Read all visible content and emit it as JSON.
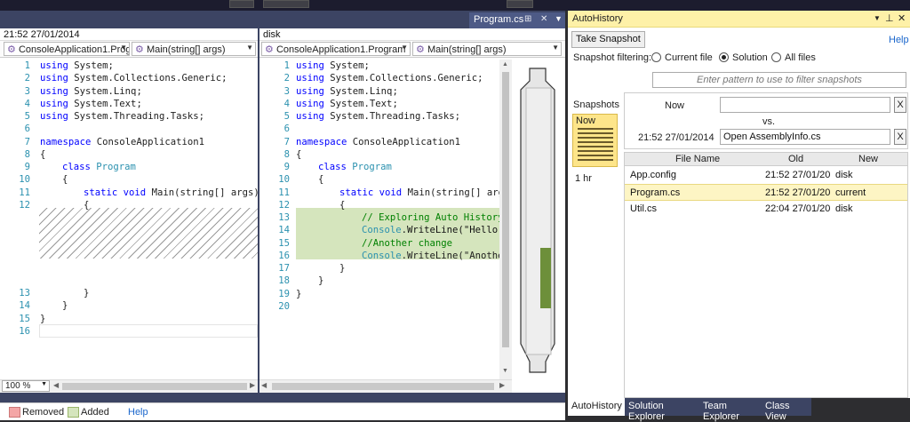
{
  "document_tab": {
    "label": "Program.cs"
  },
  "left_pane": {
    "title": "21:52 27/01/2014",
    "project_combo": "ConsoleApplication1.Prog",
    "method_combo": "Main(string[] args)",
    "line_numbers": [
      "1",
      "2",
      "3",
      "4",
      "5",
      "6",
      "7",
      "8",
      "9",
      "10",
      "11",
      "12",
      "13",
      "14",
      "15",
      "16"
    ],
    "lines": {
      "l1": "System;",
      "l2": "System.Collections.Generic;",
      "l3": "System.Linq;",
      "l4": "System.Text;",
      "l5": "System.Threading.Tasks;",
      "using": "using",
      "namespace_kw": "namespace",
      "namespace_name": " ConsoleApplication1",
      "open": "{",
      "close": "}",
      "class_kw": "class",
      "class_name": " Program",
      "static_kw": "static",
      "void_kw": "void",
      "main_sig": " Main(string[] args)"
    }
  },
  "right_pane": {
    "title": "disk",
    "project_combo": "ConsoleApplication1.Program",
    "method_combo": "Main(string[] args)",
    "line_numbers": [
      "1",
      "2",
      "3",
      "4",
      "5",
      "6",
      "7",
      "8",
      "9",
      "10",
      "11",
      "12",
      "13",
      "14",
      "15",
      "16",
      "17",
      "18",
      "19",
      "20"
    ],
    "lines": {
      "main_sig": " Main(string[] arg",
      "comment1": "// Exploring Auto History",
      "console": "Console",
      "writeline1": ".WriteLine(\"Hello",
      "comment2": "//Another change",
      "writeline2": ".WriteLine(\"Anothe"
    }
  },
  "zoom": {
    "value": "100 %"
  },
  "legend": {
    "removed": "Removed",
    "added": "Added",
    "help": "Help",
    "removed_color": "#f4a6a6",
    "added_color": "#d5e5bd"
  },
  "autohistory": {
    "title": "AutoHistory",
    "take_snapshot": "Take Snapshot",
    "help": "Help",
    "filtering_label": "Snapshot filtering:",
    "filter_options": [
      "Current file",
      "Solution",
      "All files"
    ],
    "filter_selected": "Solution",
    "filter_placeholder": "Enter pattern to use to filter snapshots",
    "snapshots_label": "Snapshots",
    "timeline_now": "Now",
    "timeline_1hr": "1 hr",
    "compare_left_label": "Now",
    "compare_vs": "vs.",
    "compare_right_label": "21:52 27/01/2014",
    "compare_right_value": "Open AssemblyInfo.cs",
    "x_label": "X",
    "columns": [
      "File Name",
      "Old",
      "New"
    ],
    "rows": [
      {
        "file": "App.config",
        "old": "21:52 27/01/20",
        "new": "disk"
      },
      {
        "file": "Program.cs",
        "old": "21:52 27/01/20",
        "new": "current"
      },
      {
        "file": "Util.cs",
        "old": "22:04 27/01/20",
        "new": "disk"
      }
    ],
    "selected_row": 1,
    "bottom_tabs": [
      "AutoHistory",
      "Solution Explorer",
      "Team Explorer",
      "Class View"
    ]
  }
}
